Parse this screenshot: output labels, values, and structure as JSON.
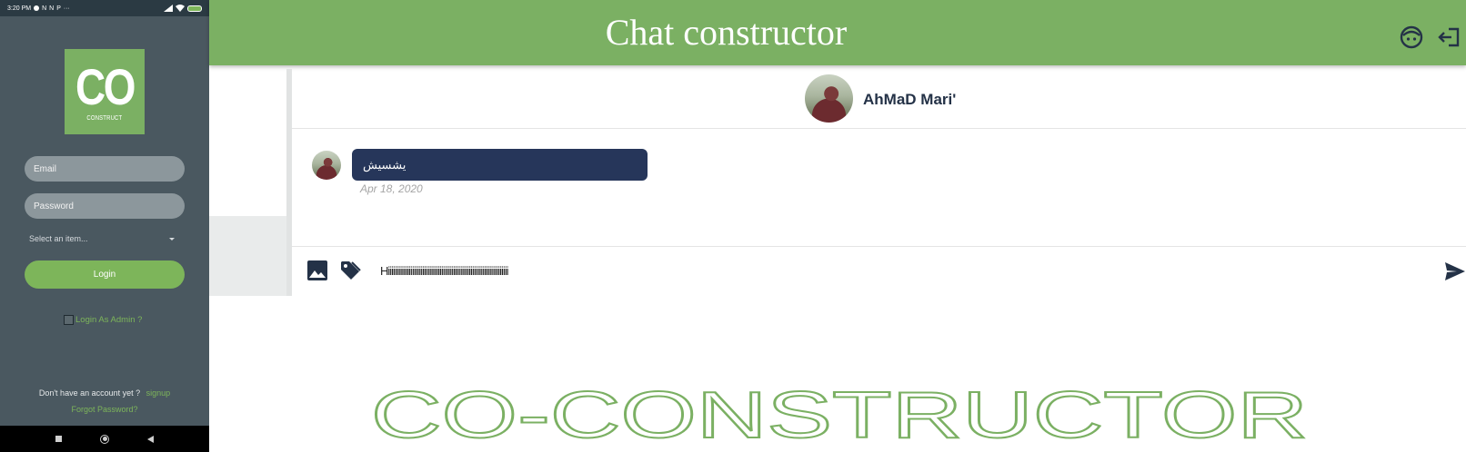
{
  "phone": {
    "status_time": "3:20 PM",
    "status_icons": [
      "check-circle-icon",
      "n-icon",
      "n-icon",
      "pin-icon",
      "more-icon"
    ],
    "status_right_icons": [
      "signal-icon",
      "wifi-icon",
      "battery-icon"
    ],
    "logo_big": "CO",
    "logo_small": "CONSTRUCT",
    "email_placeholder": "Email",
    "password_placeholder": "Password",
    "select_label": "Select an item...",
    "login_label": "Login",
    "admin_label": "Login As Admin ?",
    "no_account_text": "Don't have an account yet ?",
    "signup_label": "signup",
    "forgot_label": "Forgot Password?"
  },
  "header": {
    "title": "Chat constructor",
    "icons": [
      "user-face-icon",
      "logout-icon"
    ]
  },
  "chat": {
    "contact_name": "AhMaD Mari'",
    "message_text": "يشسيش",
    "message_date": "Apr 18, 2020",
    "composer_value": "Hiiiiiiiiiiiiiiiiiiiiiiiiiiiiiiiiiiiiiiiiiiiiiiiiiiiiiiiiiiiiiiiiiiiiii",
    "composer_icons": [
      "image-icon",
      "tag-icon",
      "send-icon"
    ]
  },
  "brand": {
    "text": "CO-CONSTRUCTOR"
  },
  "colors": {
    "brand_green": "#7bb063",
    "phone_bg": "#4a5860",
    "bubble": "#26365a",
    "name_text": "#243247"
  }
}
